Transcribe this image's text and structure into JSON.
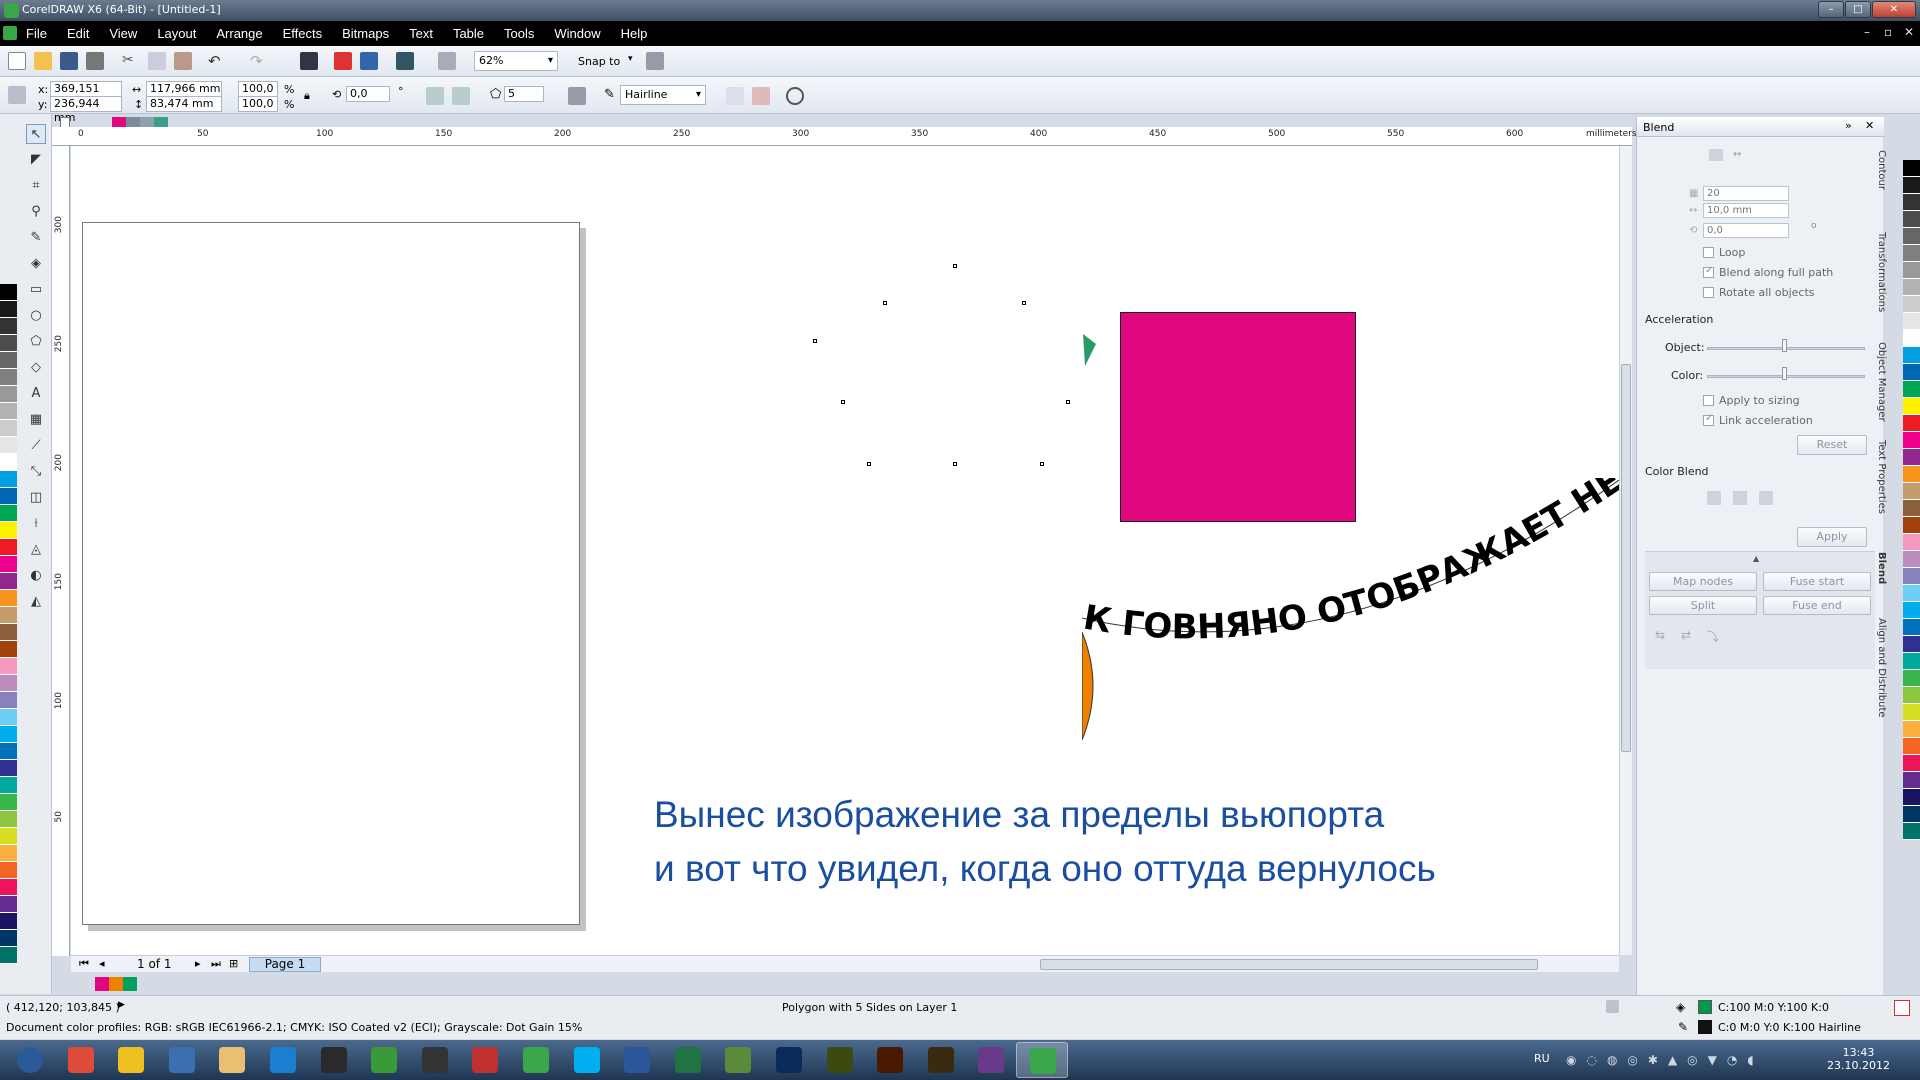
{
  "window": {
    "title": "CorelDRAW X6 (64-Bit) - [Untitled-1]"
  },
  "menu": [
    "File",
    "Edit",
    "View",
    "Layout",
    "Arrange",
    "Effects",
    "Bitmaps",
    "Text",
    "Table",
    "Tools",
    "Window",
    "Help"
  ],
  "standard_toolbar": {
    "zoom": "62%",
    "snap_to": "Snap to"
  },
  "property_bar": {
    "x": "369,151 mm",
    "y": "236,944 mm",
    "width": "117,966 mm",
    "height": "83,474 mm",
    "scale_x": "100,0",
    "scale_y": "100,0",
    "percent": "%",
    "rotation": "0,0",
    "degree": "°",
    "sides": "5",
    "outline": "Hairline"
  },
  "ruler": {
    "top_ticks": [
      "0",
      "50",
      "100",
      "150",
      "200",
      "250",
      "300",
      "350",
      "400",
      "450",
      "500",
      "550",
      "600"
    ],
    "unit": "millimeters",
    "left_ticks": [
      "300",
      "250",
      "200",
      "150",
      "100",
      "50"
    ]
  },
  "canvas": {
    "arc_text": "К ГОВНЯНО ОТОБРАЖАЕТ НЕ З",
    "note_line1": "Вынес изображение за пределы вьюпорта",
    "note_line2": "и вот что увидел, когда оно оттуда вернулось",
    "rect_color": "#e0077f",
    "orange_color": "#ee8000",
    "green_color": "#2a9a6a"
  },
  "page_nav": {
    "count": "1 of 1",
    "tab": "Page 1"
  },
  "docker": {
    "title": "Blend",
    "steps": "20",
    "spacing": "10,0 mm",
    "rotation": "0,0",
    "degree": "o",
    "loop": "Loop",
    "blend_along_full_path": "Blend along full path",
    "rotate_all_objects": "Rotate all objects",
    "acceleration": "Acceleration",
    "object": "Object:",
    "color": "Color:",
    "apply_to_sizing": "Apply to sizing",
    "link_acceleration": "Link acceleration",
    "reset": "Reset",
    "color_blend": "Color Blend",
    "apply": "Apply",
    "map_nodes": "Map nodes",
    "fuse_start": "Fuse start",
    "split": "Split",
    "fuse_end": "Fuse end",
    "tabs": [
      "Contour",
      "Transformations",
      "Object Manager",
      "Text Properties",
      "Blend",
      "Align and Distribute"
    ]
  },
  "status": {
    "coords": "( 412,120; 103,845 )",
    "object_info": "Polygon with 5 Sides on Layer 1",
    "color_profiles": "Document color profiles: RGB: sRGB IEC61966-2.1; CMYK: ISO Coated v2 (ECI); Grayscale: Dot Gain 15%",
    "fill": "C:100 M:0 Y:100 K:0",
    "outline": "C:0 M:0 Y:0 K:100  Hairline",
    "fill_color": "#009a4e",
    "outline_color": "#111111"
  },
  "taskbar": {
    "apps": [
      "Start",
      "Chrome",
      "Norton",
      "Security",
      "Explorer",
      "TeamViewer",
      "Corel",
      "uTorrent",
      "Steam",
      "64",
      "CorelDRAW",
      "Skype",
      "Word",
      "Excel",
      "Notepad",
      "Ps",
      "Dw",
      "Ai",
      "Br",
      "Photo",
      "CorelDRAW X6"
    ],
    "lang": "RU",
    "time": "13:43",
    "date": "23.10.2012"
  },
  "palette": [
    "#000000",
    "#1a1a1a",
    "#333333",
    "#4d4d4d",
    "#666666",
    "#808080",
    "#999999",
    "#b3b3b3",
    "#cccccc",
    "#e6e6e6",
    "#ffffff",
    "#00a0e3",
    "#0068b3",
    "#00a651",
    "#fff200",
    "#ed1c24",
    "#ec008c",
    "#92278f",
    "#f7941d",
    "#c69c6d",
    "#8b5e3c",
    "#a0410d",
    "#f49ac1",
    "#bd8cbf",
    "#8781bd",
    "#6dcff6",
    "#00aeef",
    "#0072bc",
    "#2e3192",
    "#00a99d",
    "#39b54a",
    "#8dc63f",
    "#d7df23",
    "#fbb040",
    "#f26522",
    "#ed145b",
    "#662d91",
    "#1b1464",
    "#003663",
    "#00746b"
  ]
}
